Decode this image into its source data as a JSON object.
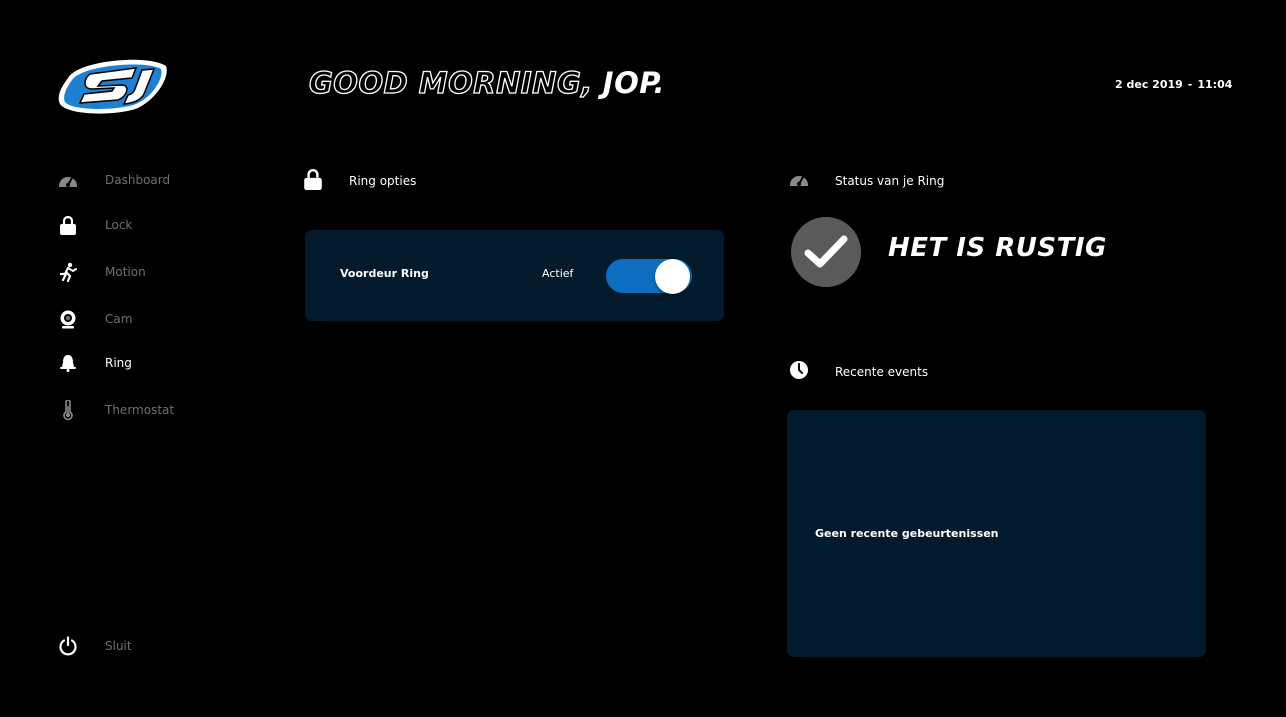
{
  "header": {
    "greeting_outline": "GOOD MORNING,",
    "greeting_name": "JOP.",
    "date": "2 dec 2019",
    "separator": "-",
    "time": "11:04"
  },
  "sidebar": {
    "items": [
      {
        "label": "Dashboard",
        "icon": "speedometer-icon"
      },
      {
        "label": "Lock",
        "icon": "lock-icon"
      },
      {
        "label": "Motion",
        "icon": "running-person-icon"
      },
      {
        "label": "Cam",
        "icon": "webcam-icon"
      },
      {
        "label": "Ring",
        "icon": "bell-icon",
        "active": true
      },
      {
        "label": "Thermostat",
        "icon": "thermometer-icon"
      }
    ],
    "close_label": "Sluit"
  },
  "ring_options": {
    "title": "Ring opties",
    "device_name": "Voordeur Ring",
    "state_label": "Actief",
    "toggle_on": true
  },
  "status": {
    "title": "Status van je Ring",
    "message": "HET IS RUSTIG"
  },
  "events": {
    "title": "Recente events",
    "empty_message": "Geen recente gebeurtenissen"
  },
  "colors": {
    "background": "#000000",
    "card": "#021a2c",
    "accent": "#0e6fc0",
    "logo_blue": "#1f7fd1",
    "muted_text": "#6f6f6f",
    "status_circle": "#5a5a5a"
  }
}
